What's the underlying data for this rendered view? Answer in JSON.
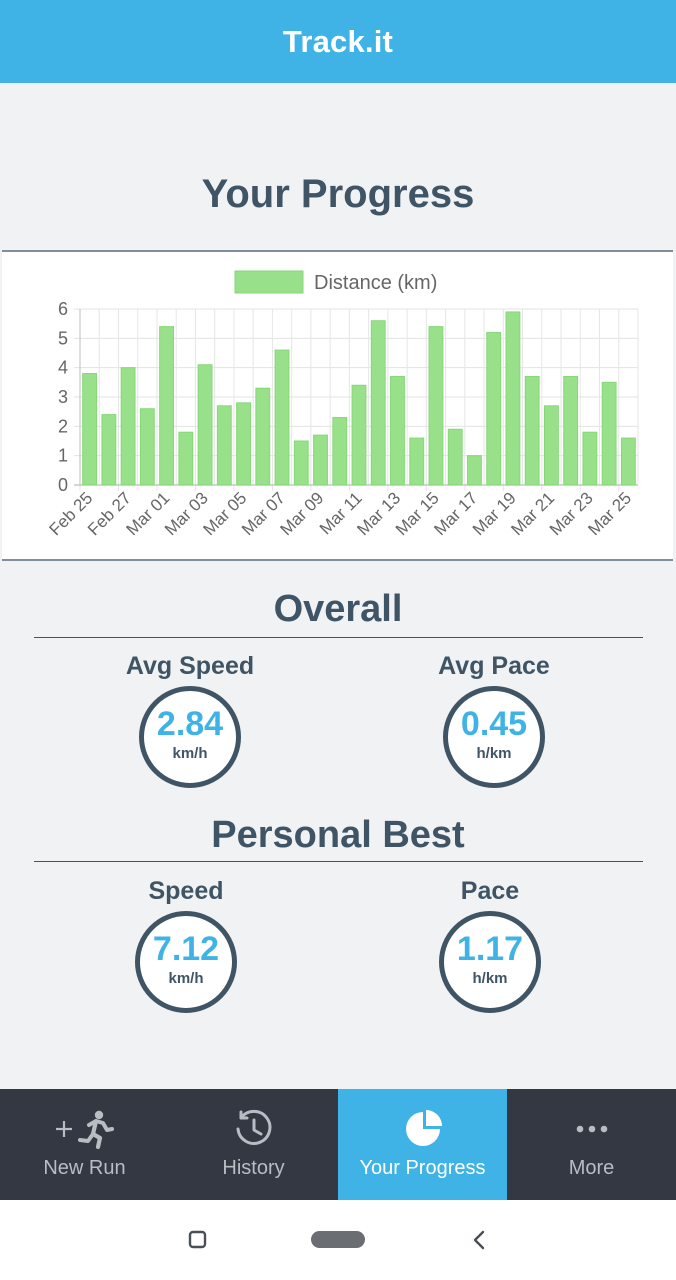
{
  "app": {
    "title": "Track.it"
  },
  "page": {
    "title": "Your Progress"
  },
  "chart_data": {
    "type": "bar",
    "legend": [
      {
        "label": "Distance (km)",
        "color": "#98e08a"
      }
    ],
    "legend_position": "top",
    "categories": [
      "Feb 25",
      "Feb 26",
      "Feb 27",
      "Feb 28",
      "Mar 01",
      "Mar 02",
      "Mar 03",
      "Mar 04",
      "Mar 05",
      "Mar 06",
      "Mar 07",
      "Mar 08",
      "Mar 09",
      "Mar 10",
      "Mar 11",
      "Mar 12",
      "Mar 13",
      "Mar 14",
      "Mar 15",
      "Mar 16",
      "Mar 17",
      "Mar 18",
      "Mar 19",
      "Mar 20",
      "Mar 21",
      "Mar 22",
      "Mar 23",
      "Mar 24",
      "Mar 25"
    ],
    "tick_labels_shown": [
      "Feb 25",
      "Feb 27",
      "Mar 01",
      "Mar 03",
      "Mar 05",
      "Mar 07",
      "Mar 09",
      "Mar 11",
      "Mar 13",
      "Mar 15",
      "Mar 17",
      "Mar 19",
      "Mar 21",
      "Mar 23",
      "Mar 25"
    ],
    "series": [
      {
        "name": "Distance (km)",
        "values": [
          3.8,
          2.4,
          4.0,
          2.6,
          5.4,
          1.8,
          4.1,
          2.7,
          2.8,
          3.3,
          4.6,
          1.5,
          1.7,
          2.3,
          3.4,
          5.6,
          3.7,
          1.6,
          5.4,
          1.9,
          1.0,
          5.2,
          5.9,
          3.7,
          2.7,
          3.7,
          1.8,
          3.5,
          1.6
        ]
      }
    ],
    "ylim": [
      0,
      6
    ],
    "yticks": [
      0,
      1,
      2,
      3,
      4,
      5,
      6
    ],
    "grid": true,
    "bar_color": "#98e08a",
    "bar_border_color": "#86d877"
  },
  "overall": {
    "title": "Overall",
    "avg_speed": {
      "label": "Avg Speed",
      "value": "2.84",
      "unit": "km/h"
    },
    "avg_pace": {
      "label": "Avg Pace",
      "value": "0.45",
      "unit": "h/km"
    }
  },
  "personal_best": {
    "title": "Personal Best",
    "speed": {
      "label": "Speed",
      "value": "7.12",
      "unit": "km/h"
    },
    "pace": {
      "label": "Pace",
      "value": "1.17",
      "unit": "h/km"
    }
  },
  "nav": {
    "items": [
      {
        "label": "New Run",
        "icon": "new-run-icon"
      },
      {
        "label": "History",
        "icon": "history-clock-icon"
      },
      {
        "label": "Your Progress",
        "icon": "pie-chart-icon",
        "active": true
      },
      {
        "label": "More",
        "icon": "more-dots-icon"
      }
    ]
  },
  "system_nav": {
    "icons": [
      "recents-square-icon",
      "home-pill-icon",
      "back-chevron-icon"
    ]
  },
  "colors": {
    "accent": "#3fb3e6",
    "dark": "#3f5566",
    "nav_bg": "#333842",
    "bar": "#98e08a"
  }
}
